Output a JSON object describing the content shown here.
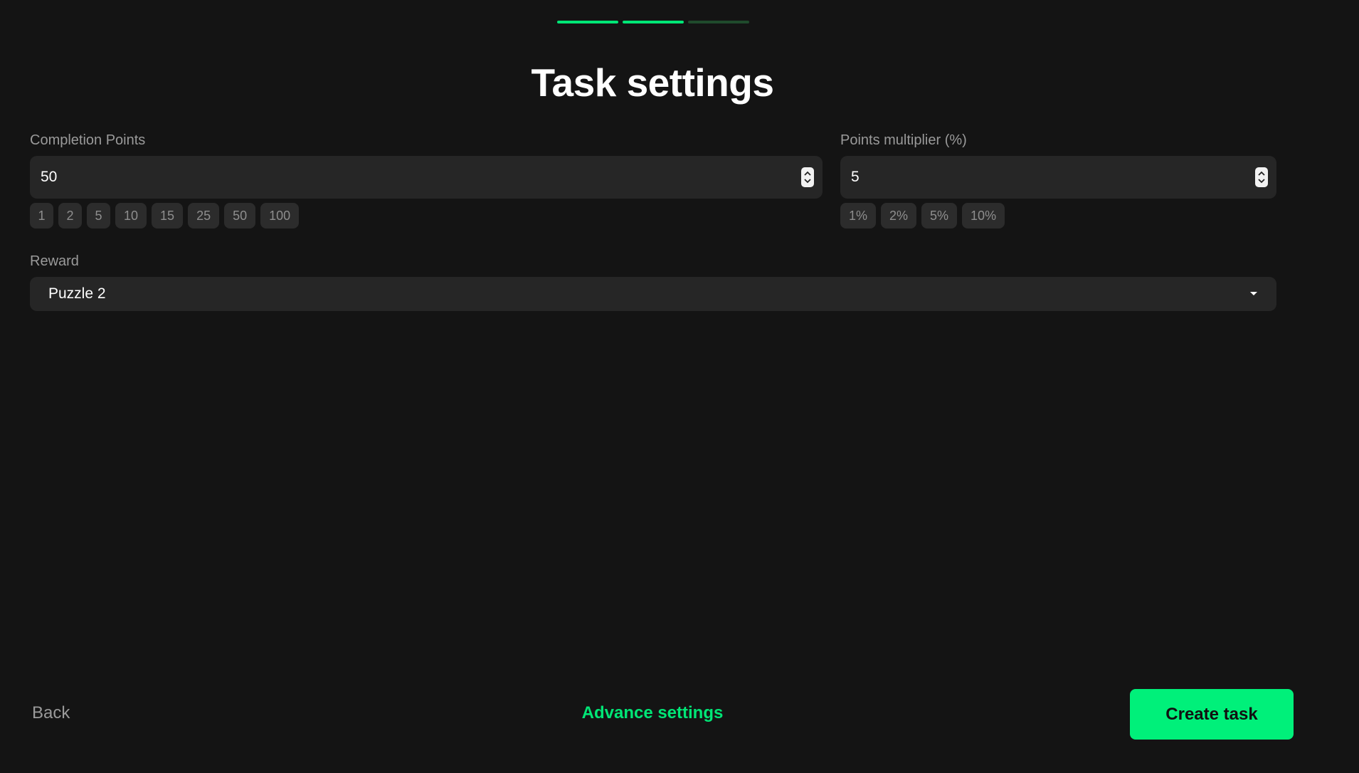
{
  "progress": {
    "steps_total": 3,
    "steps_done": 2
  },
  "header": {
    "title": "Task settings"
  },
  "completion_points": {
    "label": "Completion Points",
    "value": "50",
    "presets": [
      "1",
      "2",
      "5",
      "10",
      "15",
      "25",
      "50",
      "100"
    ]
  },
  "points_multiplier": {
    "label": "Points multiplier (%)",
    "value": "5",
    "presets": [
      "1%",
      "2%",
      "5%",
      "10%"
    ]
  },
  "reward": {
    "label": "Reward",
    "selected": "Puzzle 2"
  },
  "footer": {
    "back_label": "Back",
    "advance_label": "Advance settings",
    "create_label": "Create task"
  },
  "colors": {
    "background": "#141414",
    "accent": "#00e676",
    "accent_button": "#00f07a",
    "input_bg": "#262626",
    "chip_bg": "#2c2c2c",
    "muted_text": "#9a9a9a"
  }
}
